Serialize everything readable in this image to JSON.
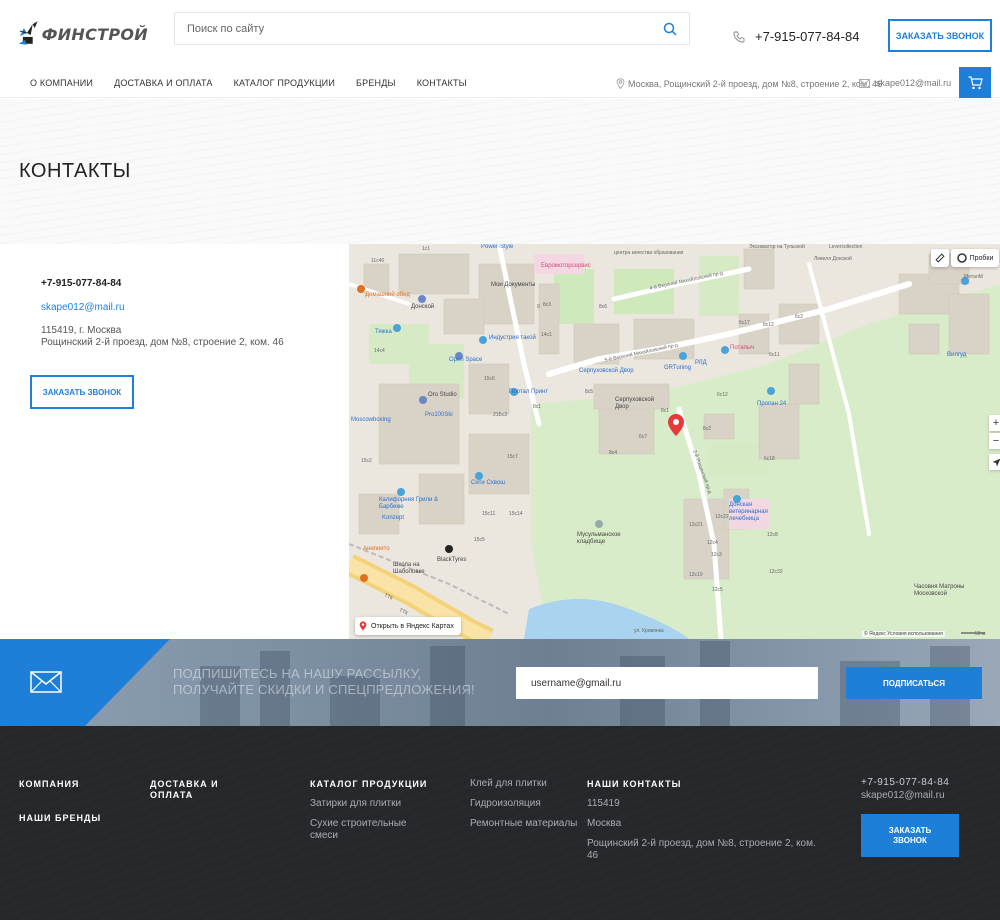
{
  "brand": {
    "name": "ФИНСТРОЙ"
  },
  "search": {
    "placeholder": "Поиск по сайту"
  },
  "header": {
    "phone": "+7-915-077-84-84",
    "call_button": "ЗАКАЗАТЬ ЗВОНОК",
    "address": "Москва, Рощинский 2-й проезд, дом №8, строение 2, ком. 46",
    "email": "skape012@mail.ru"
  },
  "nav": [
    {
      "label": "О КОМПАНИИ"
    },
    {
      "label": "ДОСТАВКА И ОПЛАТА"
    },
    {
      "label": "КАТАЛОГ ПРОДУКЦИИ"
    },
    {
      "label": "БРЕНДЫ"
    },
    {
      "label": "КОНТАКТЫ"
    }
  ],
  "page": {
    "title": "КОНТАКТЫ"
  },
  "contacts": {
    "phone": "+7-915-077-84-84",
    "email": "skape012@mail.ru",
    "city": "115419, г. Москва",
    "street": "Рощинский 2-й проезд, дом №8, строение 2, ком. 46",
    "call_button": "ЗАКАЗАТЬ ЗВОНОК"
  },
  "map": {
    "open_label": "Открыть в Яндекс Картах",
    "traffic_label": "Пробки",
    "zoom_in": "+",
    "zoom_out": "−",
    "copyright": "© Яндекс   Условия использования",
    "scale": "50 м",
    "labels": {
      "power_style": "Power-Style",
      "euroservice": "Евромоторсервис",
      "moi_documenty": "Мои Документы",
      "domashny_obed": "Домашний обед",
      "tiajka": "Тяжка",
      "donskoy": "Донской",
      "industry": "Индустрия такой",
      "open_space": "Open Space",
      "oro_studio": "Oro Studio",
      "portal_print": "Портал Принт",
      "pro100ski": "Pro100Ski",
      "moscowboxing": "Moscowboxing",
      "siti_skhosh": "Сити Схвош",
      "kalifornia": "Калифорния Грили & Барбекю",
      "konzept": "Konzept",
      "anipiito": "Анипиито",
      "school": "Школа на Шаболовке",
      "blacktyres": "BlackTyres",
      "serpukhovsky": "Серпуховской Двор",
      "grtuning": "GRTuning",
      "rld": "РЛД",
      "potapych": "Потапыч",
      "propan": "Пропан 24",
      "vet": "Донская ветеринарная лечебница",
      "muslim": "Мусульманское кладбище",
      "chasovnya": "Часовня Матроны Московской",
      "levell": "Левелл Донской",
      "ekskavator": "Экскаватор на Тульской",
      "metall": "МеталМ",
      "vilgud": "Вилгуд",
      "tsentr": "центра качества образования",
      "verkhny4": "4-й Верхний Михайловский пр-д",
      "verkhny5": "5-й Верхний Михайловский пр-д",
      "roshchinsky": "2-й Рощинский пр-д",
      "ttk1": "ТТК",
      "ttk2": "ТТК",
      "krovenka": "ул. Кровянка",
      "levercollection": "Levercollection",
      "b11c40": "11с40",
      "b1c1": "1с1",
      "b9": "9",
      "b14c4": "14с4",
      "b15c5": "15с5",
      "b15c6": "15с6",
      "b14c1": "14с1",
      "b21bc3": "21Бс3",
      "b8c1": "8с1",
      "b15c7": "15с7",
      "b15c11": "15с11",
      "b15c14": "15с14",
      "b15c2": "15с2",
      "b8c6": "8с6",
      "b8c5": "8с5",
      "b8c3": "8с3",
      "b8c4": "8с4",
      "b6c7": "6с7",
      "b8c1r": "8с1",
      "b8c2": "8с2",
      "b6c12": "6с12",
      "b6c11": "6с11",
      "b6c2": "6с2",
      "b6c18": "6с18",
      "b6c17": "6с17",
      "b12c21": "12с21",
      "b12c4": "12с4",
      "b12c3": "12с3",
      "b12c32": "12с32",
      "b12c8": "12с8",
      "b12c19": "12с19",
      "b12c5": "12с5",
      "b12c14": "12с14",
      "b8c12": "8с12",
      "b6c5": "6с5",
      "b12c22": "12с22"
    }
  },
  "subscribe": {
    "line1": "ПОДПИШИТЕСЬ НА НАШУ РАССЫЛКУ,",
    "line2": "ПОЛУЧАЙТЕ СКИДКИ И СПЕЦПРЕДЛОЖЕНИЯ!",
    "input_value": "username@gmail.ru",
    "button": "ПОДПИСАТЬСЯ"
  },
  "footer": {
    "company": "КОМПАНИЯ",
    "brands": "НАШИ БРЕНДЫ",
    "delivery_line1": "ДОСТАВКА И",
    "delivery_line2": "ОПЛАТА",
    "catalog": "КАТАЛОГ ПРОДУКЦИИ",
    "catalog_items": [
      "Затирки для плитки",
      "Сухие строительные",
      "смеси"
    ],
    "catalog_items2": [
      "Клей для плитки",
      "Гидроизоляция",
      "Ремонтные материалы"
    ],
    "contacts_title": "НАШИ КОНТАКТЫ",
    "zip": "115419",
    "city": "Москва",
    "street_line1": "Рощинский 2-й проезд, дом №8, строение 2, ком.",
    "street_line2": "46",
    "phone": "+7-915-077-84-84",
    "email": "skape012@mail.ru",
    "call_line1": "ЗАКАЗАТЬ",
    "call_line2": "ЗВОНОК"
  },
  "colors": {
    "accent": "#1e7fd9",
    "footer_bg": "#25272b"
  }
}
